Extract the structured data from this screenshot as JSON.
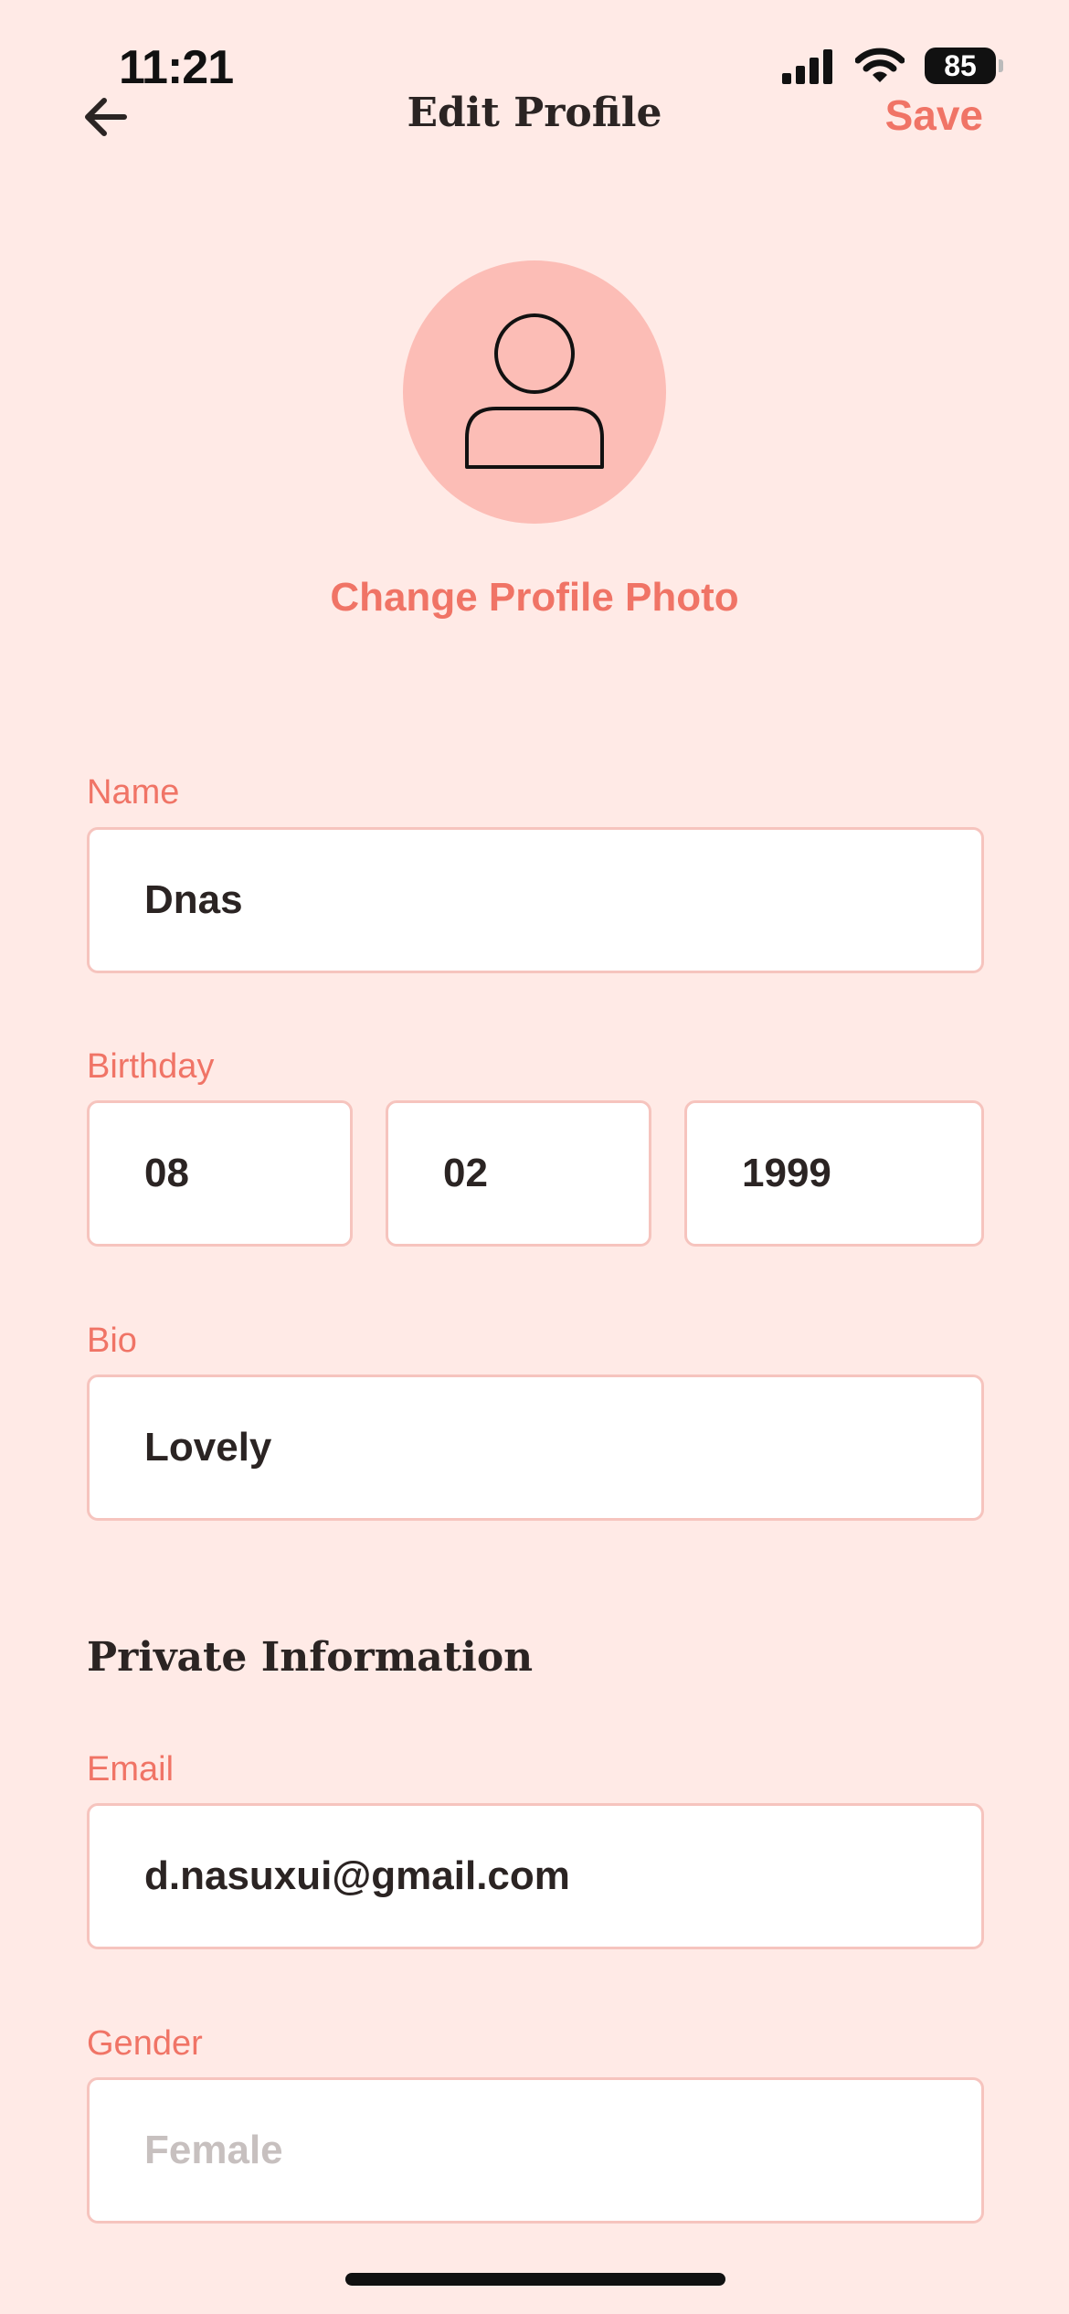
{
  "status_bar": {
    "time": "11:21",
    "battery": "85"
  },
  "header": {
    "title": "Edit Profile",
    "save_label": "Save",
    "back_icon": "arrow-left-icon"
  },
  "profile": {
    "avatar_icon": "user-icon",
    "change_photo_label": "Change Profile Photo"
  },
  "form": {
    "name": {
      "label": "Name",
      "value": "Dnas"
    },
    "birthday": {
      "label": "Birthday",
      "month": "08",
      "day": "02",
      "year": "1999"
    },
    "bio": {
      "label": "Bio",
      "value": "Lovely"
    }
  },
  "private": {
    "heading": "Private Information",
    "email": {
      "label": "Email",
      "value": "d.nasuxui@gmail.com"
    },
    "gender": {
      "label": "Gender",
      "placeholder": "Female"
    }
  },
  "colors": {
    "background": "#FFEAE6",
    "accent": "#F07466",
    "avatar_bg": "#FCBDB6",
    "input_border": "#F6C4BE",
    "text": "#2B2423"
  }
}
